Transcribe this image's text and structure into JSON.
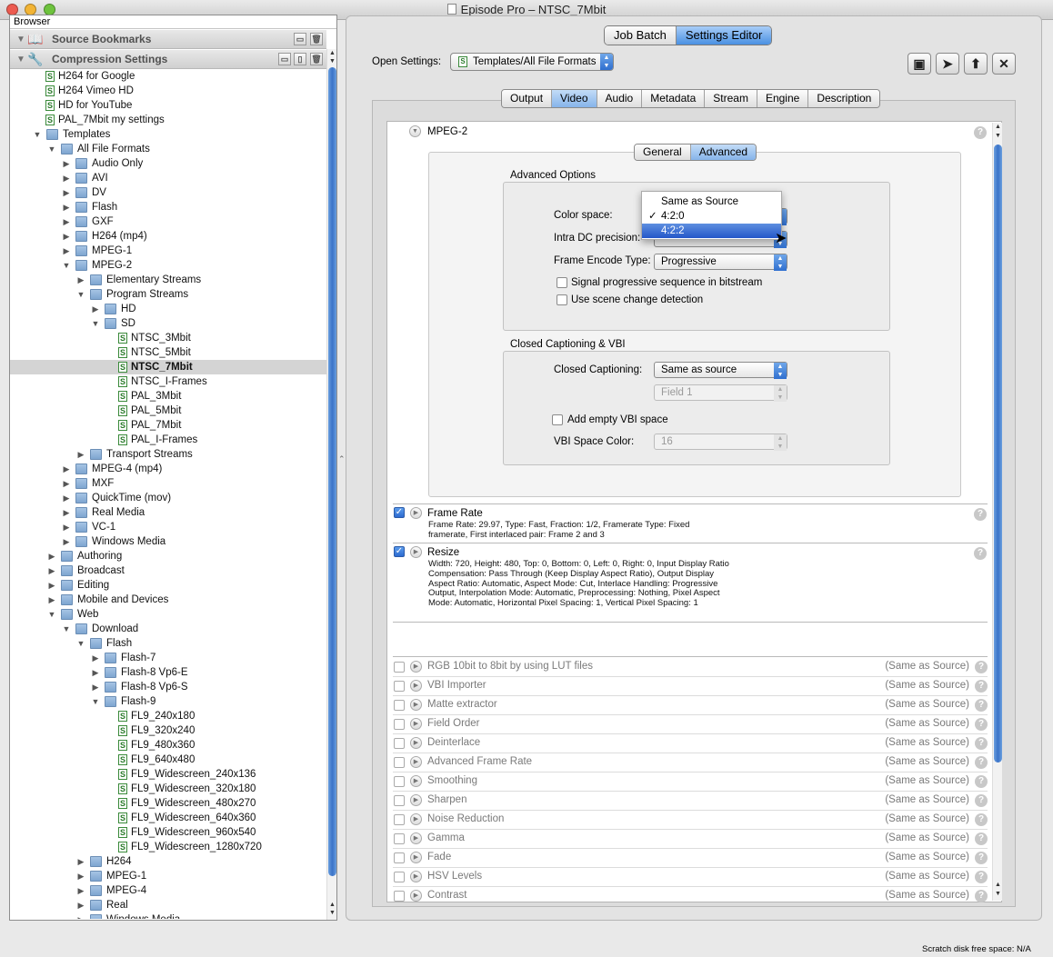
{
  "window": {
    "title": "Episode Pro – NTSC_7Mbit"
  },
  "browser": {
    "header": "Browser",
    "sections": [
      {
        "label": "Source Bookmarks"
      },
      {
        "label": "Compression Settings"
      }
    ],
    "tree": [
      {
        "label": "H264 for Google",
        "depth": 0,
        "type": "file"
      },
      {
        "label": "H264 Vimeo HD",
        "depth": 0,
        "type": "file"
      },
      {
        "label": "HD for YouTube",
        "depth": 0,
        "type": "file"
      },
      {
        "label": "PAL_7Mbit my settings",
        "depth": 0,
        "type": "file"
      },
      {
        "label": "Templates",
        "depth": 0,
        "type": "folder",
        "expanded": true
      },
      {
        "label": "All File Formats",
        "depth": 1,
        "type": "folder",
        "expanded": true
      },
      {
        "label": "Audio Only",
        "depth": 2,
        "type": "folder"
      },
      {
        "label": "AVI",
        "depth": 2,
        "type": "folder"
      },
      {
        "label": "DV",
        "depth": 2,
        "type": "folder"
      },
      {
        "label": "Flash",
        "depth": 2,
        "type": "folder"
      },
      {
        "label": "GXF",
        "depth": 2,
        "type": "folder"
      },
      {
        "label": "H264 (mp4)",
        "depth": 2,
        "type": "folder"
      },
      {
        "label": "MPEG-1",
        "depth": 2,
        "type": "folder"
      },
      {
        "label": "MPEG-2",
        "depth": 2,
        "type": "folder",
        "expanded": true
      },
      {
        "label": "Elementary Streams",
        "depth": 3,
        "type": "folder"
      },
      {
        "label": "Program Streams",
        "depth": 3,
        "type": "folder",
        "expanded": true
      },
      {
        "label": "HD",
        "depth": 4,
        "type": "folder"
      },
      {
        "label": "SD",
        "depth": 4,
        "type": "folder",
        "expanded": true
      },
      {
        "label": "NTSC_3Mbit",
        "depth": 5,
        "type": "file"
      },
      {
        "label": "NTSC_5Mbit",
        "depth": 5,
        "type": "file"
      },
      {
        "label": "NTSC_7Mbit",
        "depth": 5,
        "type": "file",
        "selected": true
      },
      {
        "label": "NTSC_I-Frames",
        "depth": 5,
        "type": "file"
      },
      {
        "label": "PAL_3Mbit",
        "depth": 5,
        "type": "file"
      },
      {
        "label": "PAL_5Mbit",
        "depth": 5,
        "type": "file"
      },
      {
        "label": "PAL_7Mbit",
        "depth": 5,
        "type": "file"
      },
      {
        "label": "PAL_I-Frames",
        "depth": 5,
        "type": "file"
      },
      {
        "label": "Transport Streams",
        "depth": 3,
        "type": "folder"
      },
      {
        "label": "MPEG-4 (mp4)",
        "depth": 2,
        "type": "folder"
      },
      {
        "label": "MXF",
        "depth": 2,
        "type": "folder"
      },
      {
        "label": "QuickTime (mov)",
        "depth": 2,
        "type": "folder"
      },
      {
        "label": "Real Media",
        "depth": 2,
        "type": "folder"
      },
      {
        "label": "VC-1",
        "depth": 2,
        "type": "folder"
      },
      {
        "label": "Windows Media",
        "depth": 2,
        "type": "folder"
      },
      {
        "label": "Authoring",
        "depth": 1,
        "type": "folder"
      },
      {
        "label": "Broadcast",
        "depth": 1,
        "type": "folder"
      },
      {
        "label": "Editing",
        "depth": 1,
        "type": "folder"
      },
      {
        "label": "Mobile and Devices",
        "depth": 1,
        "type": "folder"
      },
      {
        "label": "Web",
        "depth": 1,
        "type": "folder",
        "expanded": true
      },
      {
        "label": "Download",
        "depth": 2,
        "type": "folder",
        "expanded": true
      },
      {
        "label": "Flash",
        "depth": 3,
        "type": "folder",
        "expanded": true
      },
      {
        "label": "Flash-7",
        "depth": 4,
        "type": "folder"
      },
      {
        "label": "Flash-8 Vp6-E",
        "depth": 4,
        "type": "folder"
      },
      {
        "label": "Flash-8 Vp6-S",
        "depth": 4,
        "type": "folder"
      },
      {
        "label": "Flash-9",
        "depth": 4,
        "type": "folder",
        "expanded": true
      },
      {
        "label": "FL9_240x180",
        "depth": 5,
        "type": "file"
      },
      {
        "label": "FL9_320x240",
        "depth": 5,
        "type": "file"
      },
      {
        "label": "FL9_480x360",
        "depth": 5,
        "type": "file"
      },
      {
        "label": "FL9_640x480",
        "depth": 5,
        "type": "file"
      },
      {
        "label": "FL9_Widescreen_240x136",
        "depth": 5,
        "type": "file"
      },
      {
        "label": "FL9_Widescreen_320x180",
        "depth": 5,
        "type": "file"
      },
      {
        "label": "FL9_Widescreen_480x270",
        "depth": 5,
        "type": "file"
      },
      {
        "label": "FL9_Widescreen_640x360",
        "depth": 5,
        "type": "file"
      },
      {
        "label": "FL9_Widescreen_960x540",
        "depth": 5,
        "type": "file"
      },
      {
        "label": "FL9_Widescreen_1280x720",
        "depth": 5,
        "type": "file"
      },
      {
        "label": "H264",
        "depth": 3,
        "type": "folder"
      },
      {
        "label": "MPEG-1",
        "depth": 3,
        "type": "folder"
      },
      {
        "label": "MPEG-4",
        "depth": 3,
        "type": "folder"
      },
      {
        "label": "Real",
        "depth": 3,
        "type": "folder"
      },
      {
        "label": "Windows Media",
        "depth": 3,
        "type": "folder"
      }
    ]
  },
  "main_tabs": {
    "job_batch": "Job Batch",
    "settings_editor": "Settings Editor"
  },
  "open_settings": {
    "label": "Open Settings:",
    "value": "Templates/All File Formats"
  },
  "tabs": [
    "Output",
    "Video",
    "Audio",
    "Metadata",
    "Stream",
    "Engine",
    "Description"
  ],
  "active_tab": "Video",
  "mpeg2": {
    "title": "MPEG-2",
    "subtabs": {
      "general": "General",
      "advanced": "Advanced"
    },
    "advanced_options": {
      "title": "Advanced Options",
      "color_space_label": "Color space:",
      "intra_dc_label": "Intra DC precision:",
      "frame_encode_label": "Frame Encode Type:",
      "frame_encode_value": "Progressive",
      "signal_progressive": "Signal progressive sequence in bitstream",
      "scene_change": "Use scene change detection"
    },
    "cc": {
      "title": "Closed Captioning & VBI",
      "cc_label": "Closed Captioning:",
      "cc_value": "Same as source",
      "field_value": "Field 1",
      "add_vbi": "Add empty VBI space",
      "vbi_color_label": "VBI Space Color:",
      "vbi_color_value": "16"
    }
  },
  "color_menu": {
    "options": [
      "Same as Source",
      "4:2:0",
      "4:2:2"
    ],
    "checked": "4:2:0",
    "highlighted": "4:2:2"
  },
  "frame_rate": {
    "title": "Frame Rate",
    "desc": "Frame Rate: 29.97, Type: Fast, Fraction: 1/2, Framerate Type: Fixed framerate, First interlaced pair: Frame 2 and 3"
  },
  "resize": {
    "title": "Resize",
    "desc": "Width: 720, Height: 480, Top: 0, Bottom: 0, Left: 0, Right: 0, Input Display Ratio Compensation: Pass Through (Keep Display Aspect Ratio), Output Display Aspect Ratio: Automatic, Aspect Mode: Cut, Interlace Handling: Progressive Output, Interpolation Mode: Automatic, Preprocessing: Nothing, Pixel Aspect Mode: Automatic, Horizontal Pixel Spacing: 1, Vertical Pixel Spacing: 1"
  },
  "filters": [
    {
      "name": "RGB 10bit to 8bit by using LUT files",
      "value": "(Same as Source)"
    },
    {
      "name": "VBI Importer",
      "value": "(Same as Source)"
    },
    {
      "name": "Matte extractor",
      "value": "(Same as Source)"
    },
    {
      "name": "Field Order",
      "value": "(Same as Source)"
    },
    {
      "name": "Deinterlace",
      "value": "(Same as Source)"
    },
    {
      "name": "Advanced Frame Rate",
      "value": "(Same as Source)"
    },
    {
      "name": "Smoothing",
      "value": "(Same as Source)"
    },
    {
      "name": "Sharpen",
      "value": "(Same as Source)"
    },
    {
      "name": "Noise Reduction",
      "value": "(Same as Source)"
    },
    {
      "name": "Gamma",
      "value": "(Same as Source)"
    },
    {
      "name": "Fade",
      "value": "(Same as Source)"
    },
    {
      "name": "HSV Levels",
      "value": "(Same as Source)"
    },
    {
      "name": "Contrast",
      "value": "(Same as Source)"
    }
  ],
  "status": {
    "scratch": "Scratch disk free space: N/A"
  }
}
